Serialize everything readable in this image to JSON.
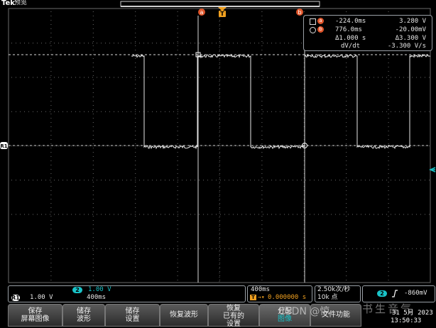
{
  "header": {
    "brand": "Tek",
    "mode": "预览"
  },
  "markers": {
    "cursor_a": "a",
    "cursor_b": "b",
    "trigger_pos": "T",
    "channel_ref": "R1"
  },
  "cursor_readout": {
    "rows": [
      {
        "symbol": "a",
        "col1": "-224.0ms",
        "col2": "3.280 V"
      },
      {
        "symbol": "b",
        "col1": "776.0ms",
        "col2": "-20.00mV"
      },
      {
        "symbol": "",
        "col1": "Δ1.000 s",
        "col2": "Δ3.300 V"
      },
      {
        "symbol": "",
        "col1": "dV/dt",
        "col2": "-3.300 V/s"
      }
    ]
  },
  "status": {
    "ch2_badge": "2",
    "ch2_scale": "1.00 V",
    "r1_badge": "R1",
    "r1_scale": "1.00 V",
    "r1_time": "400ms",
    "timebase": "400ms",
    "trigger_icon": "T",
    "trigger_delay": "0.000000 s",
    "sample_rate": "2.50k次/秒",
    "record_length": "10k 点",
    "trig_badge": "2",
    "trig_slope_icon": "rising-edge-icon",
    "trig_level": "-860mV"
  },
  "softkeys": [
    {
      "line1": "保存",
      "line2": "屏幕图像"
    },
    {
      "line1": "储存",
      "line2": "波形"
    },
    {
      "line1": "储存",
      "line2": "设置"
    },
    {
      "line1": "恢复波形",
      "line2": ""
    },
    {
      "line1": "恢复",
      "line2": "已有的",
      "line3": "设置"
    },
    {
      "line1": "分配",
      "line2": "图像"
    },
    {
      "line1": "文件功能",
      "line2": ""
    }
  ],
  "overlay": {
    "watermark": "CSDN @惊",
    "watermark2": "书生音气",
    "date_line1": "31 5月 2023",
    "date_line2": "13:50:33"
  },
  "colors": {
    "trace": "#e8e8e8",
    "accent_cyan": "#19c3c8",
    "marker_orange": "#e0552a",
    "trigger_orange": "#f0a020",
    "grid": "#5a5a5a"
  }
}
